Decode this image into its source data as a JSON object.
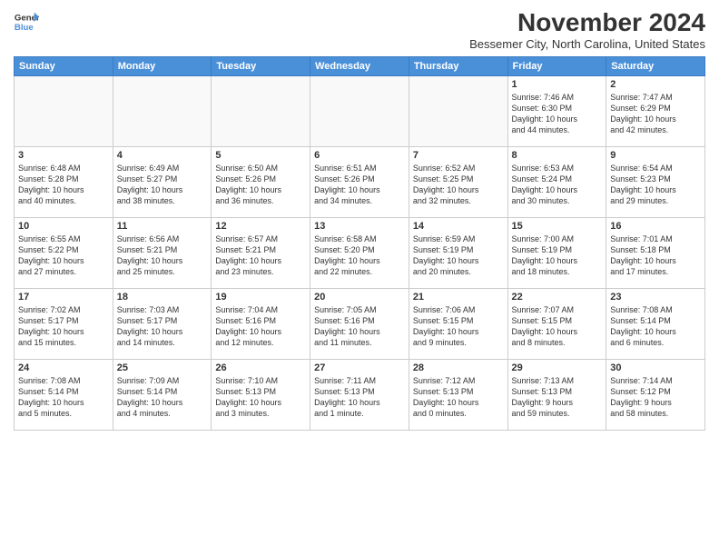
{
  "logo": {
    "line1": "General",
    "line2": "Blue"
  },
  "title": "November 2024",
  "subtitle": "Bessemer City, North Carolina, United States",
  "weekdays": [
    "Sunday",
    "Monday",
    "Tuesday",
    "Wednesday",
    "Thursday",
    "Friday",
    "Saturday"
  ],
  "weeks": [
    [
      {
        "day": "",
        "info": ""
      },
      {
        "day": "",
        "info": ""
      },
      {
        "day": "",
        "info": ""
      },
      {
        "day": "",
        "info": ""
      },
      {
        "day": "",
        "info": ""
      },
      {
        "day": "1",
        "info": "Sunrise: 7:46 AM\nSunset: 6:30 PM\nDaylight: 10 hours\nand 44 minutes."
      },
      {
        "day": "2",
        "info": "Sunrise: 7:47 AM\nSunset: 6:29 PM\nDaylight: 10 hours\nand 42 minutes."
      }
    ],
    [
      {
        "day": "3",
        "info": "Sunrise: 6:48 AM\nSunset: 5:28 PM\nDaylight: 10 hours\nand 40 minutes."
      },
      {
        "day": "4",
        "info": "Sunrise: 6:49 AM\nSunset: 5:27 PM\nDaylight: 10 hours\nand 38 minutes."
      },
      {
        "day": "5",
        "info": "Sunrise: 6:50 AM\nSunset: 5:26 PM\nDaylight: 10 hours\nand 36 minutes."
      },
      {
        "day": "6",
        "info": "Sunrise: 6:51 AM\nSunset: 5:26 PM\nDaylight: 10 hours\nand 34 minutes."
      },
      {
        "day": "7",
        "info": "Sunrise: 6:52 AM\nSunset: 5:25 PM\nDaylight: 10 hours\nand 32 minutes."
      },
      {
        "day": "8",
        "info": "Sunrise: 6:53 AM\nSunset: 5:24 PM\nDaylight: 10 hours\nand 30 minutes."
      },
      {
        "day": "9",
        "info": "Sunrise: 6:54 AM\nSunset: 5:23 PM\nDaylight: 10 hours\nand 29 minutes."
      }
    ],
    [
      {
        "day": "10",
        "info": "Sunrise: 6:55 AM\nSunset: 5:22 PM\nDaylight: 10 hours\nand 27 minutes."
      },
      {
        "day": "11",
        "info": "Sunrise: 6:56 AM\nSunset: 5:21 PM\nDaylight: 10 hours\nand 25 minutes."
      },
      {
        "day": "12",
        "info": "Sunrise: 6:57 AM\nSunset: 5:21 PM\nDaylight: 10 hours\nand 23 minutes."
      },
      {
        "day": "13",
        "info": "Sunrise: 6:58 AM\nSunset: 5:20 PM\nDaylight: 10 hours\nand 22 minutes."
      },
      {
        "day": "14",
        "info": "Sunrise: 6:59 AM\nSunset: 5:19 PM\nDaylight: 10 hours\nand 20 minutes."
      },
      {
        "day": "15",
        "info": "Sunrise: 7:00 AM\nSunset: 5:19 PM\nDaylight: 10 hours\nand 18 minutes."
      },
      {
        "day": "16",
        "info": "Sunrise: 7:01 AM\nSunset: 5:18 PM\nDaylight: 10 hours\nand 17 minutes."
      }
    ],
    [
      {
        "day": "17",
        "info": "Sunrise: 7:02 AM\nSunset: 5:17 PM\nDaylight: 10 hours\nand 15 minutes."
      },
      {
        "day": "18",
        "info": "Sunrise: 7:03 AM\nSunset: 5:17 PM\nDaylight: 10 hours\nand 14 minutes."
      },
      {
        "day": "19",
        "info": "Sunrise: 7:04 AM\nSunset: 5:16 PM\nDaylight: 10 hours\nand 12 minutes."
      },
      {
        "day": "20",
        "info": "Sunrise: 7:05 AM\nSunset: 5:16 PM\nDaylight: 10 hours\nand 11 minutes."
      },
      {
        "day": "21",
        "info": "Sunrise: 7:06 AM\nSunset: 5:15 PM\nDaylight: 10 hours\nand 9 minutes."
      },
      {
        "day": "22",
        "info": "Sunrise: 7:07 AM\nSunset: 5:15 PM\nDaylight: 10 hours\nand 8 minutes."
      },
      {
        "day": "23",
        "info": "Sunrise: 7:08 AM\nSunset: 5:14 PM\nDaylight: 10 hours\nand 6 minutes."
      }
    ],
    [
      {
        "day": "24",
        "info": "Sunrise: 7:08 AM\nSunset: 5:14 PM\nDaylight: 10 hours\nand 5 minutes."
      },
      {
        "day": "25",
        "info": "Sunrise: 7:09 AM\nSunset: 5:14 PM\nDaylight: 10 hours\nand 4 minutes."
      },
      {
        "day": "26",
        "info": "Sunrise: 7:10 AM\nSunset: 5:13 PM\nDaylight: 10 hours\nand 3 minutes."
      },
      {
        "day": "27",
        "info": "Sunrise: 7:11 AM\nSunset: 5:13 PM\nDaylight: 10 hours\nand 1 minute."
      },
      {
        "day": "28",
        "info": "Sunrise: 7:12 AM\nSunset: 5:13 PM\nDaylight: 10 hours\nand 0 minutes."
      },
      {
        "day": "29",
        "info": "Sunrise: 7:13 AM\nSunset: 5:13 PM\nDaylight: 9 hours\nand 59 minutes."
      },
      {
        "day": "30",
        "info": "Sunrise: 7:14 AM\nSunset: 5:12 PM\nDaylight: 9 hours\nand 58 minutes."
      }
    ]
  ]
}
